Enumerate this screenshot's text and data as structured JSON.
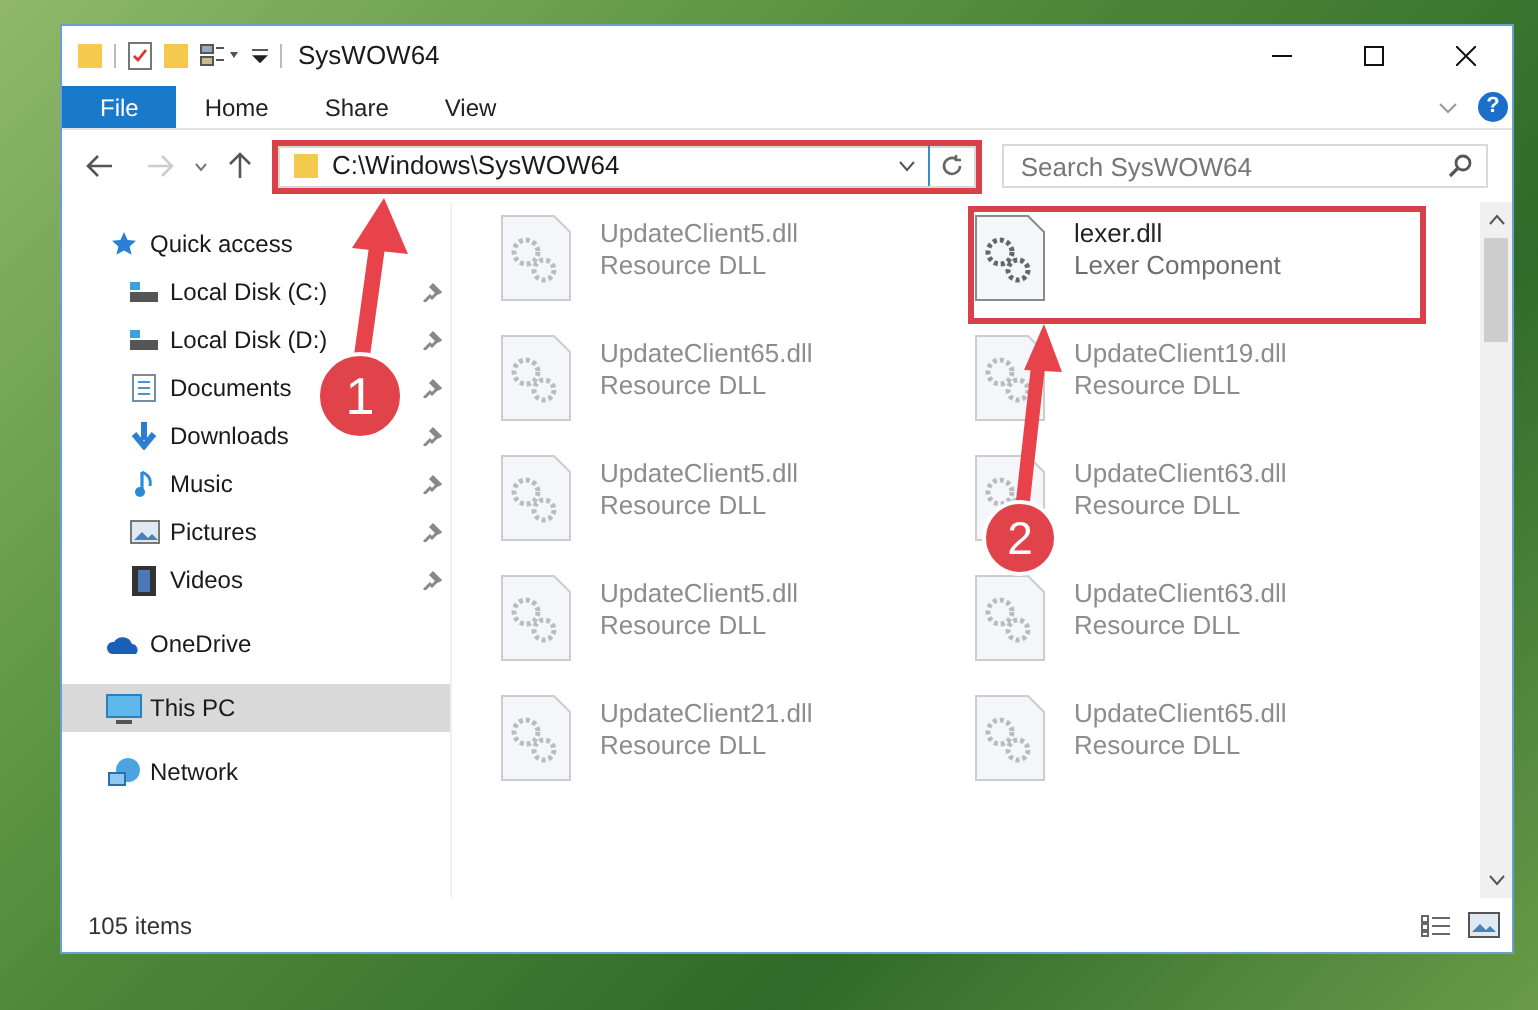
{
  "window": {
    "title": "SysWOW64"
  },
  "ribbon_tabs": [
    {
      "label": "File",
      "selected": true
    },
    {
      "label": "Home",
      "selected": false
    },
    {
      "label": "Share",
      "selected": false
    },
    {
      "label": "View",
      "selected": false
    }
  ],
  "help": {
    "label": "?"
  },
  "address": {
    "path": "C:\\Windows\\SysWOW64",
    "highlighted": true
  },
  "search": {
    "placeholder": "Search SysWOW64"
  },
  "sidebar": {
    "items": [
      {
        "label": "Quick access",
        "kind": "star",
        "selected": false,
        "children": [
          {
            "label": "Local Disk (C:)",
            "kind": "drive",
            "pinned": true,
            "selected": false
          },
          {
            "label": "Local Disk (D:)",
            "kind": "drive",
            "pinned": true,
            "selected": false
          },
          {
            "label": "Documents",
            "kind": "documents",
            "pinned": true,
            "selected": false
          },
          {
            "label": "Downloads",
            "kind": "downloads",
            "pinned": true,
            "selected": false
          },
          {
            "label": "Music",
            "kind": "music",
            "pinned": true,
            "selected": false
          },
          {
            "label": "Pictures",
            "kind": "pictures",
            "pinned": true,
            "selected": false
          },
          {
            "label": "Videos",
            "kind": "videos",
            "pinned": true,
            "selected": false
          }
        ]
      },
      {
        "label": "OneDrive",
        "kind": "cloud",
        "selected": false
      },
      {
        "label": "This PC",
        "kind": "pc",
        "selected": true
      },
      {
        "label": "Network",
        "kind": "network",
        "selected": false
      }
    ]
  },
  "files": [
    {
      "name": "UpdateClient5.dll",
      "type": "Resource DLL",
      "blurred": true,
      "highlighted": false
    },
    {
      "name": "lexer.dll",
      "type": "Lexer Component",
      "blurred": false,
      "highlighted": true
    },
    {
      "name": "UpdateClient65.dll",
      "type": "Resource DLL",
      "blurred": true,
      "highlighted": false
    },
    {
      "name": "UpdateClient19.dll",
      "type": "Resource DLL",
      "blurred": true,
      "highlighted": false
    },
    {
      "name": "UpdateClient5.dll",
      "type": "Resource DLL",
      "blurred": true,
      "highlighted": false
    },
    {
      "name": "UpdateClient63.dll",
      "type": "Resource DLL",
      "blurred": true,
      "highlighted": false
    },
    {
      "name": "UpdateClient5.dll",
      "type": "Resource DLL",
      "blurred": true,
      "highlighted": false
    },
    {
      "name": "UpdateClient63.dll",
      "type": "Resource DLL",
      "blurred": true,
      "highlighted": false
    },
    {
      "name": "UpdateClient21.dll",
      "type": "Resource DLL",
      "blurred": true,
      "highlighted": false
    },
    {
      "name": "UpdateClient65.dll",
      "type": "Resource DLL",
      "blurred": true,
      "highlighted": false
    }
  ],
  "status_bar": {
    "count": "105 items"
  },
  "annotations": [
    {
      "label": "1"
    },
    {
      "label": "2"
    }
  ]
}
